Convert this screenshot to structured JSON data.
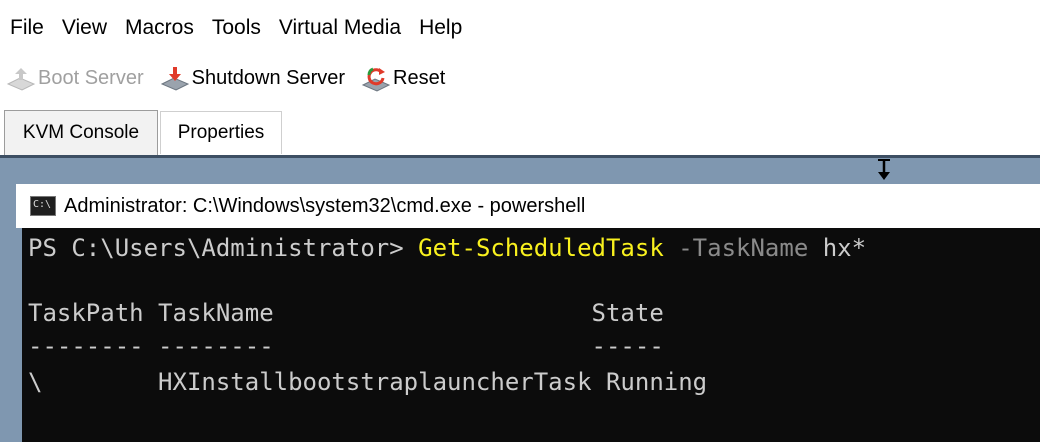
{
  "menu": [
    "File",
    "View",
    "Macros",
    "Tools",
    "Virtual Media",
    "Help"
  ],
  "toolbar": {
    "boot_label": "Boot Server",
    "shutdown_label": "Shutdown Server",
    "reset_label": "Reset"
  },
  "tabs": {
    "active": "KVM Console",
    "inactive": "Properties"
  },
  "console": {
    "window_title": "Administrator: C:\\Windows\\system32\\cmd.exe - powershell",
    "prompt": "PS C:\\Users\\Administrator> ",
    "command": "Get-ScheduledTask",
    "param": " -TaskName ",
    "arg": "hx*",
    "header": "TaskPath TaskName                      State",
    "divider": "-------- --------                      -----",
    "row": "\\        HXInstallbootstraplauncherTask Running"
  },
  "colors": {
    "accent_frame": "#7f97b0",
    "terminal_bg": "#0c0c0c",
    "command_yellow": "#f9f11e",
    "param_gray": "#8a8a8a"
  }
}
